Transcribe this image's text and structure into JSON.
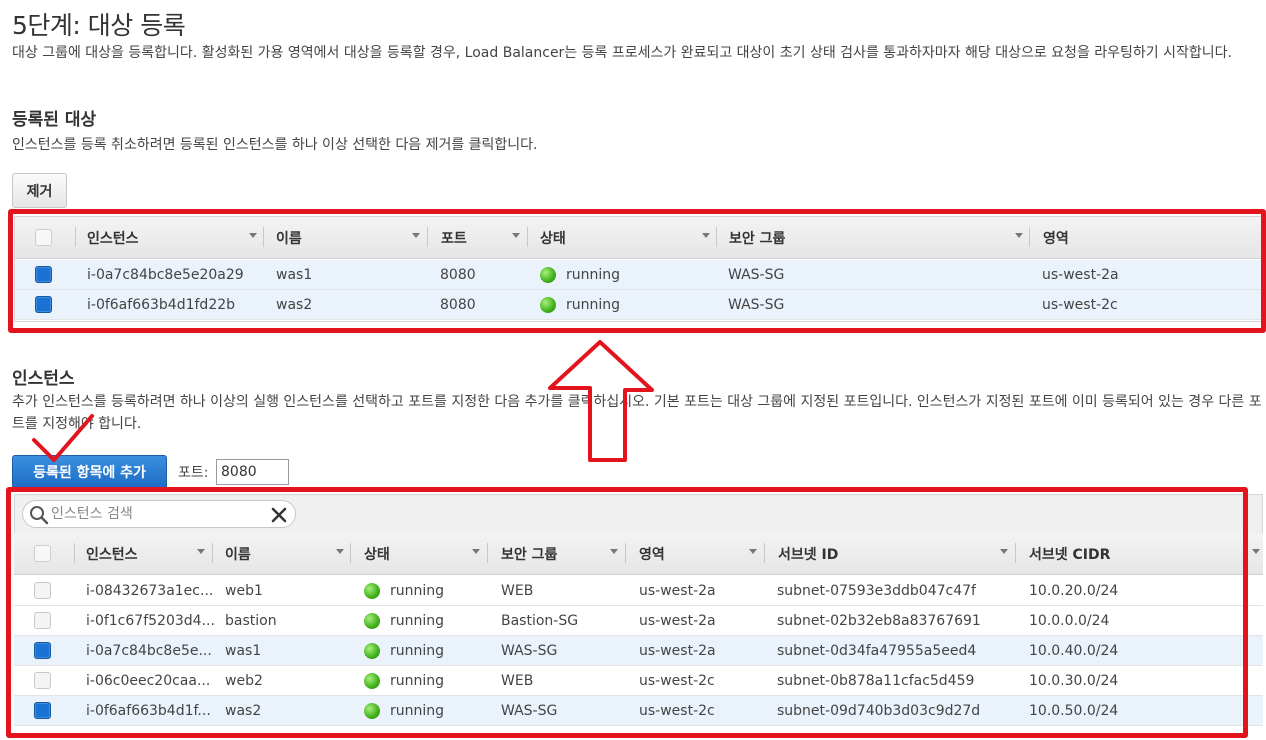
{
  "page": {
    "title": "5단계: 대상 등록",
    "description": "대상 그룹에 대상을 등록합니다. 활성화된 가용 영역에서 대상을 등록할 경우, Load Balancer는 등록 프로세스가 완료되고 대상이 초기 상태 검사를 통과하자마자 해당 대상으로 요청을 라우팅하기 시작합니다."
  },
  "registered": {
    "title": "등록된 대상",
    "description": "인스턴스를 등록 취소하려면 등록된 인스턴스를 하나 이상 선택한 다음 제거를 클릭합니다.",
    "remove_label": "제거",
    "columns": [
      "인스턴스",
      "이름",
      "포트",
      "상태",
      "보안 그룹",
      "영역"
    ],
    "rows": [
      {
        "instance": "i-0a7c84bc8e5e20a29",
        "name": "was1",
        "port": "8080",
        "status": "running",
        "sg": "WAS-SG",
        "zone": "us-west-2a",
        "checked": true
      },
      {
        "instance": "i-0f6af663b4d1fd22b",
        "name": "was2",
        "port": "8080",
        "status": "running",
        "sg": "WAS-SG",
        "zone": "us-west-2c",
        "checked": true
      }
    ]
  },
  "instances": {
    "title": "인스턴스",
    "description": "추가 인스턴스를 등록하려면 하나 이상의 실행 인스턴스를 선택하고 포트를 지정한 다음 추가를 클릭하십시오. 기본 포트는 대상 그룹에 지정된 포트입니다. 인스턴스가 지정된 포트에 이미 등록되어 있는 경우 다른 포트를 지정해야 합니다.",
    "add_label": "등록된 항목에 추가",
    "port_label": "포트:",
    "port_value": "8080",
    "search_placeholder": "인스턴스 검색",
    "columns": [
      "인스턴스",
      "이름",
      "상태",
      "보안 그룹",
      "영역",
      "서브넷 ID",
      "서브넷 CIDR"
    ],
    "rows": [
      {
        "instance": "i-08432673a1ec...",
        "name": "web1",
        "status": "running",
        "sg": "WEB",
        "zone": "us-west-2a",
        "subnet": "subnet-07593e3ddb047c47f",
        "cidr": "10.0.20.0/24",
        "checked": false
      },
      {
        "instance": "i-0f1c67f5203d4...",
        "name": "bastion",
        "status": "running",
        "sg": "Bastion-SG",
        "zone": "us-west-2a",
        "subnet": "subnet-02b32eb8a83767691",
        "cidr": "10.0.0.0/24",
        "checked": false
      },
      {
        "instance": "i-0a7c84bc8e5e...",
        "name": "was1",
        "status": "running",
        "sg": "WAS-SG",
        "zone": "us-west-2a",
        "subnet": "subnet-0d34fa47955a5eed4",
        "cidr": "10.0.40.0/24",
        "checked": true
      },
      {
        "instance": "i-06c0eec20caa...",
        "name": "web2",
        "status": "running",
        "sg": "WEB",
        "zone": "us-west-2c",
        "subnet": "subnet-0b878a11cfac5d459",
        "cidr": "10.0.30.0/24",
        "checked": false
      },
      {
        "instance": "i-0f6af663b4d1f...",
        "name": "was2",
        "status": "running",
        "sg": "WAS-SG",
        "zone": "us-west-2c",
        "subnet": "subnet-09d740b3d03c9d27d",
        "cidr": "10.0.50.0/24",
        "checked": true
      }
    ]
  },
  "colors": {
    "annotation_red": "#e3141e",
    "selected_row": "#eaf2fb",
    "checkbox_blue": "#1a73d4",
    "status_green": "#3fae1a"
  }
}
